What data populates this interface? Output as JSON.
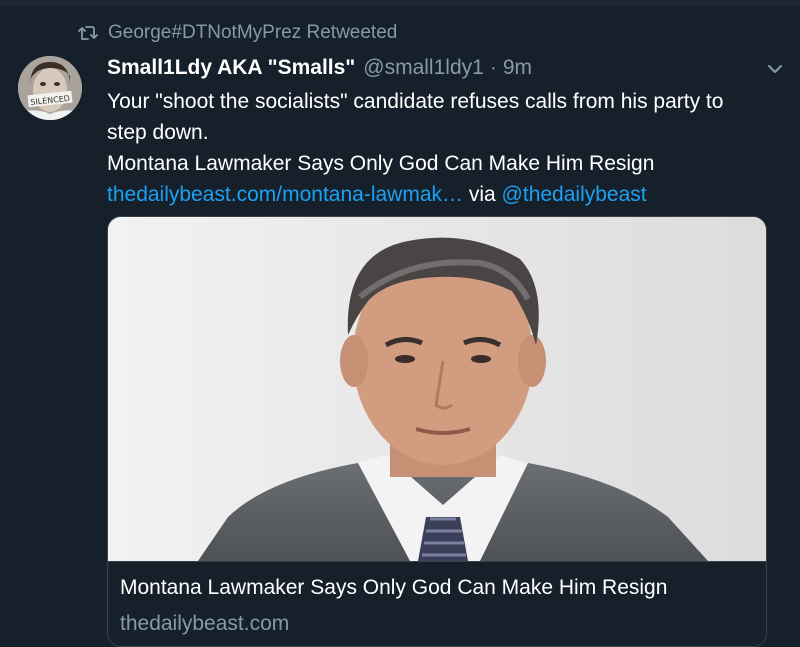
{
  "retweet": {
    "icon": "retweet-icon",
    "text": "George#DTNotMyPrez Retweeted"
  },
  "tweet": {
    "avatar_text": "SILENCED",
    "display_name": "Small1Ldy AKA \"Smalls\"",
    "handle": "@small1ldy1",
    "separator": "·",
    "time": "9m",
    "body_line1": "Your \"shoot the socialists\" candidate refuses calls from his party to step down.",
    "body_line2": "Montana Lawmaker Says Only God Can Make Him Resign",
    "link_text": "thedailybeast.com/montana-lawmak…",
    "via_text": "via",
    "mention": "@thedailybeast",
    "menu_icon": "chevron-down-icon"
  },
  "card": {
    "image_alt": "man-in-suit-photo",
    "title": "Montana Lawmaker Says Only God Can Make Him Resign",
    "domain": "thedailybeast.com"
  },
  "colors": {
    "background": "#15202b",
    "secondary_text": "#8899a6",
    "link": "#1da1f2",
    "border": "#38444d"
  }
}
